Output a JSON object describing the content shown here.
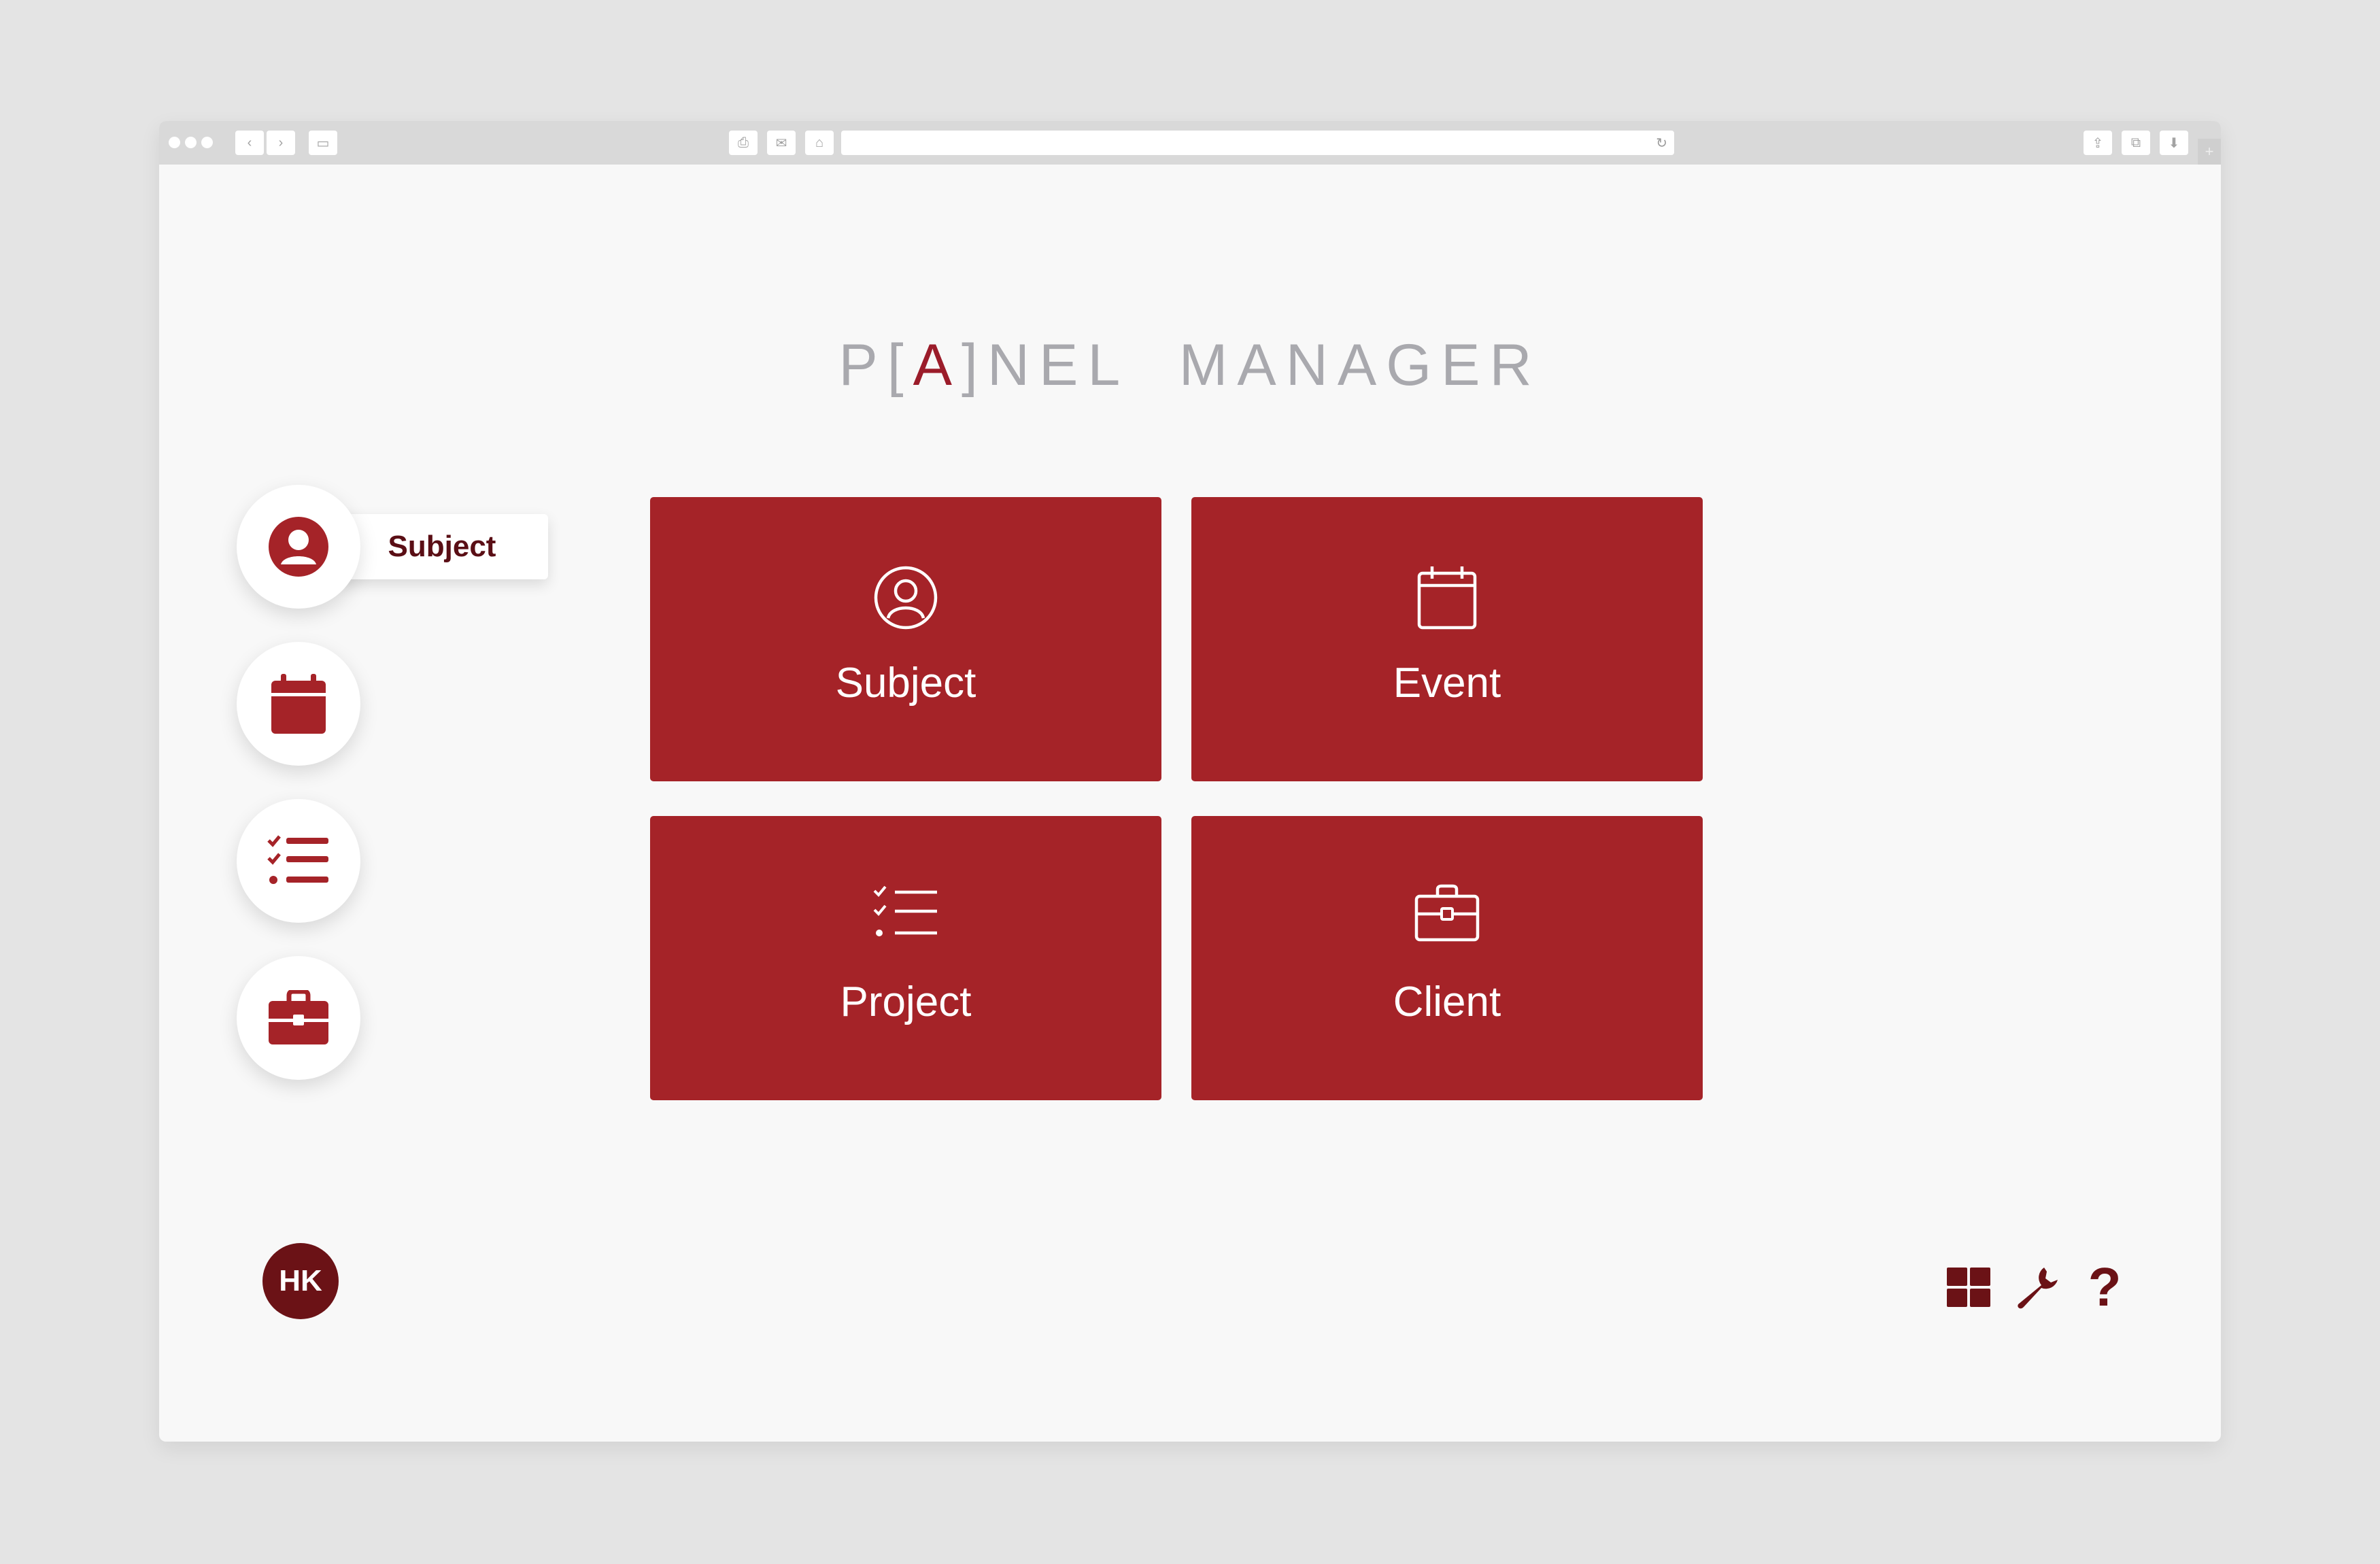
{
  "app": {
    "title_prefix": "P[",
    "title_accent": "A",
    "title_suffix": "]NEL  MANAGER"
  },
  "browser": {
    "toolbar_icons": [
      "back-icon",
      "forward-icon",
      "sidebar-icon",
      "print-icon",
      "mail-icon",
      "home-icon",
      "reload-icon",
      "share-icon",
      "tabs-icon",
      "download-icon"
    ],
    "new_tab_label": "+"
  },
  "sidebar": {
    "items": [
      {
        "id": "subject",
        "icon": "user-icon",
        "tooltip": "Subject"
      },
      {
        "id": "event",
        "icon": "calendar-icon"
      },
      {
        "id": "project",
        "icon": "checklist-icon"
      },
      {
        "id": "client",
        "icon": "briefcase-icon"
      }
    ]
  },
  "tiles": [
    {
      "label": "Subject",
      "icon": "user-icon"
    },
    {
      "label": "Event",
      "icon": "calendar-icon"
    },
    {
      "label": "Project",
      "icon": "checklist-icon"
    },
    {
      "label": "Client",
      "icon": "briefcase-icon"
    }
  ],
  "user": {
    "initials": "HK"
  },
  "tools": [
    {
      "icon": "grid-icon"
    },
    {
      "icon": "wrench-icon"
    },
    {
      "icon": "help-icon",
      "glyph": "?"
    }
  ],
  "colors": {
    "accent": "#a52328",
    "dark_accent": "#6b1216",
    "title_gray": "#a9a9ae",
    "background": "#f8f8f8"
  }
}
